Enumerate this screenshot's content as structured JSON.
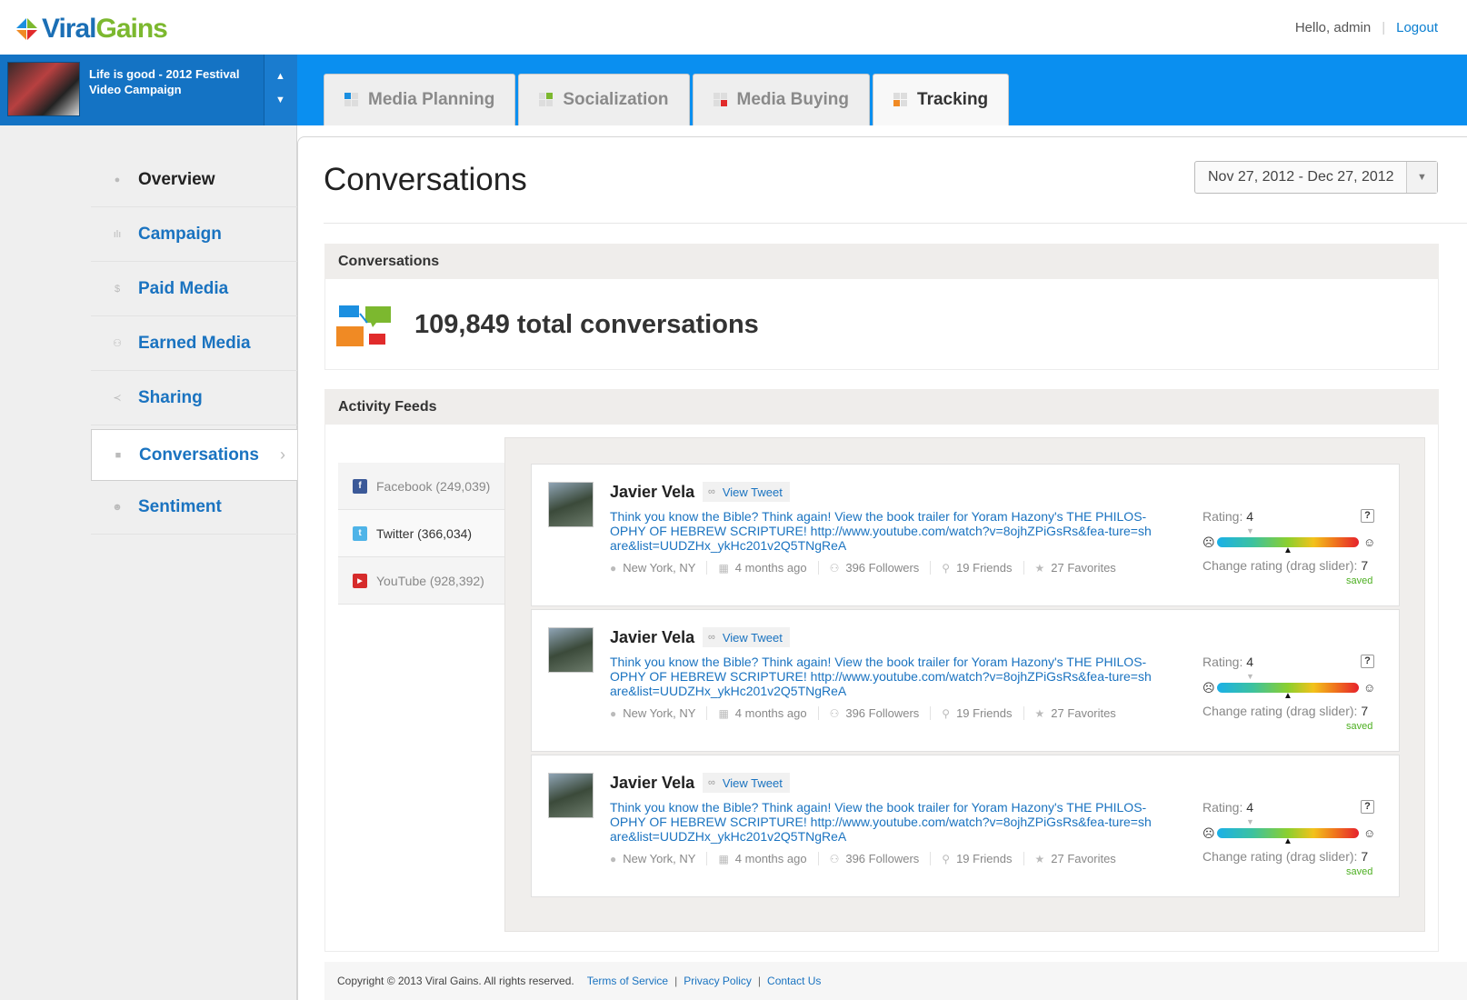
{
  "brand": {
    "name_part1": "Viral",
    "name_part2": "Gains"
  },
  "header": {
    "greeting": "Hello, admin",
    "logout_label": "Logout"
  },
  "campaign": {
    "title": "Life is good - 2012 Festival Video Campaign"
  },
  "tabs": [
    {
      "label": "Media Planning",
      "icon": "pinwheel-icon",
      "active": false
    },
    {
      "label": "Socialization",
      "icon": "pinwheel-icon",
      "active": false
    },
    {
      "label": "Media Buying",
      "icon": "pinwheel-icon",
      "active": false
    },
    {
      "label": "Tracking",
      "icon": "pinwheel-icon",
      "active": true
    }
  ],
  "sidebar": {
    "items": [
      {
        "label": "Overview",
        "icon": "globe-icon"
      },
      {
        "label": "Campaign",
        "icon": "bar-chart-icon"
      },
      {
        "label": "Paid Media",
        "icon": "dollar-icon"
      },
      {
        "label": "Earned Media",
        "icon": "people-icon"
      },
      {
        "label": "Sharing",
        "icon": "share-icon"
      },
      {
        "label": "Conversations",
        "icon": "speech-bubble-icon",
        "active": true
      },
      {
        "label": "Sentiment",
        "icon": "smiley-icon"
      }
    ]
  },
  "page": {
    "title": "Conversations",
    "date_range": "Nov 27, 2012 - Dec 27, 2012"
  },
  "conversations_panel": {
    "heading": "Conversations",
    "total": "109,849 total conversations"
  },
  "activity_panel": {
    "heading": "Activity Feeds",
    "sources": [
      {
        "label": "Facebook (249,039)",
        "icon": "facebook-icon",
        "active": false
      },
      {
        "label": "Twitter (366,034)",
        "icon": "twitter-icon",
        "active": true
      },
      {
        "label": "YouTube (928,392)",
        "icon": "youtube-icon",
        "active": false
      }
    ]
  },
  "feed": [
    {
      "user": "Javier Vela",
      "view_label": "View Tweet",
      "text": "Think you know the Bible? Think again! View the book trailer for Yoram Hazony's THE PHILOS-OPHY OF HEBREW SCRIPTURE! http://www.youtube.com/watch?v=8ojhZPiGsRs&fea-ture=share&list=UUDZHx_ykHc201v2Q5TNgReA",
      "location": "New York, NY",
      "time": "4 months ago",
      "followers": "396 Followers",
      "friends": "19 Friends",
      "favorites": "27 Favorites",
      "rating_label": "Rating:",
      "rating_value": "4",
      "change_label": "Change rating (drag slider):",
      "change_value": "7",
      "status": "saved",
      "help": "?"
    },
    {
      "user": "Javier Vela",
      "view_label": "View Tweet",
      "text": "Think you know the Bible? Think again! View the book trailer for Yoram Hazony's THE PHILOS-OPHY OF HEBREW SCRIPTURE! http://www.youtube.com/watch?v=8ojhZPiGsRs&fea-ture=share&list=UUDZHx_ykHc201v2Q5TNgReA",
      "location": "New York, NY",
      "time": "4 months ago",
      "followers": "396 Followers",
      "friends": "19 Friends",
      "favorites": "27 Favorites",
      "rating_label": "Rating:",
      "rating_value": "4",
      "change_label": "Change rating (drag slider):",
      "change_value": "7",
      "status": "saved",
      "help": "?"
    },
    {
      "user": "Javier Vela",
      "view_label": "View Tweet",
      "text": "Think you know the Bible? Think again! View the book trailer for Yoram Hazony's THE PHILOS-OPHY OF HEBREW SCRIPTURE! http://www.youtube.com/watch?v=8ojhZPiGsRs&fea-ture=share&list=UUDZHx_ykHc201v2Q5TNgReA",
      "location": "New York, NY",
      "time": "4 months ago",
      "followers": "396 Followers",
      "friends": "19 Friends",
      "favorites": "27 Favorites",
      "rating_label": "Rating:",
      "rating_value": "4",
      "change_label": "Change rating (drag slider):",
      "change_value": "7",
      "status": "saved",
      "help": "?"
    }
  ],
  "footer": {
    "copyright": "Copyright © 2013 Viral Gains. All rights reserved.",
    "links": [
      "Terms of Service",
      "Privacy Policy",
      "Contact Us"
    ]
  },
  "colors": {
    "accent_blue": "#0a8ff0",
    "link_blue": "#1a73c0",
    "saved_green": "#4caf20"
  }
}
